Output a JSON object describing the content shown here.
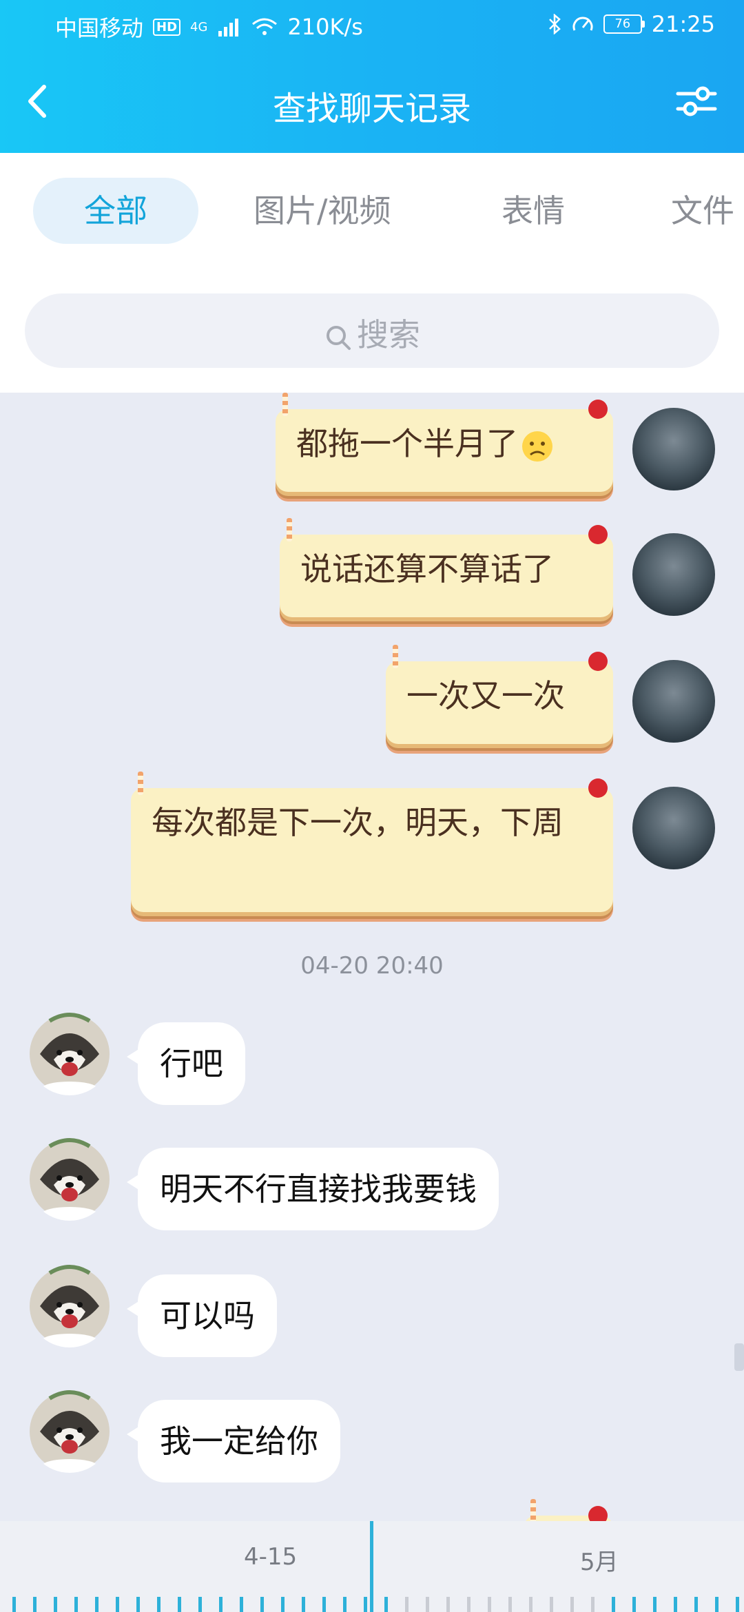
{
  "status_bar": {
    "carrier": "中国移动",
    "hd": "HD",
    "network": "4G",
    "speed": "210K/s",
    "battery": "76",
    "time": "21:25"
  },
  "header": {
    "title": "查找聊天记录"
  },
  "tabs": [
    {
      "label": "全部",
      "active": true
    },
    {
      "label": "图片/视频",
      "active": false
    },
    {
      "label": "表情",
      "active": false
    },
    {
      "label": "文件",
      "active": false
    }
  ],
  "search": {
    "placeholder": "搜索"
  },
  "messages": {
    "sent": [
      {
        "text": "都拖一个半月了"
      },
      {
        "text": "说话还算不算话了"
      },
      {
        "text": "一次又一次"
      },
      {
        "text": "每次都是下一次，明天，下周"
      }
    ],
    "timestamp": "04-20 20:40",
    "received": [
      {
        "text": "行吧"
      },
      {
        "text": "明天不行直接找我要钱"
      },
      {
        "text": "可以吗"
      },
      {
        "text": "我一定给你"
      }
    ]
  },
  "timeline": {
    "labels": [
      "4-15",
      "5月"
    ]
  },
  "colors": {
    "accent": "#1ab3f4",
    "timeline": "#2db1d9",
    "cake_bubble": "#fbf1c4"
  }
}
